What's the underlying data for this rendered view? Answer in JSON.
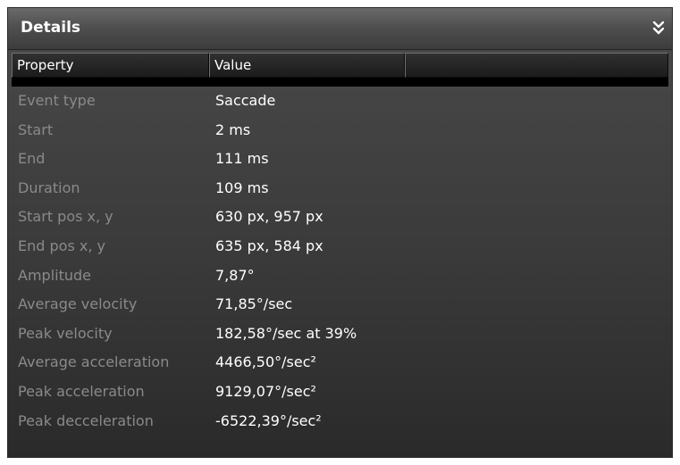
{
  "panel": {
    "title": "Details",
    "collapse_icon": "double-chevron-down-icon"
  },
  "table": {
    "columns": [
      "Property",
      "Value",
      ""
    ],
    "rows": [
      {
        "property": "Event type",
        "value": "Saccade"
      },
      {
        "property": "Start",
        "value": "2 ms"
      },
      {
        "property": "End",
        "value": "111 ms"
      },
      {
        "property": "Duration",
        "value": "109 ms"
      },
      {
        "property": "Start pos x, y",
        "value": "630 px, 957 px"
      },
      {
        "property": "End pos x, y",
        "value": "635 px, 584 px"
      },
      {
        "property": "Amplitude",
        "value": "7,87°"
      },
      {
        "property": "Average velocity",
        "value": "71,85°/sec"
      },
      {
        "property": "Peak velocity",
        "value": "182,58°/sec at 39%"
      },
      {
        "property": "Average acceleration",
        "value": "4466,50°/sec²"
      },
      {
        "property": "Peak acceleration",
        "value": "9129,07°/sec²"
      },
      {
        "property": "Peak decceleration",
        "value": "-6522,39°/sec²"
      }
    ]
  },
  "colors": {
    "property_text": "#8a8a8a",
    "value_text": "#ffffff",
    "panel_background": "#3a3a3a"
  }
}
